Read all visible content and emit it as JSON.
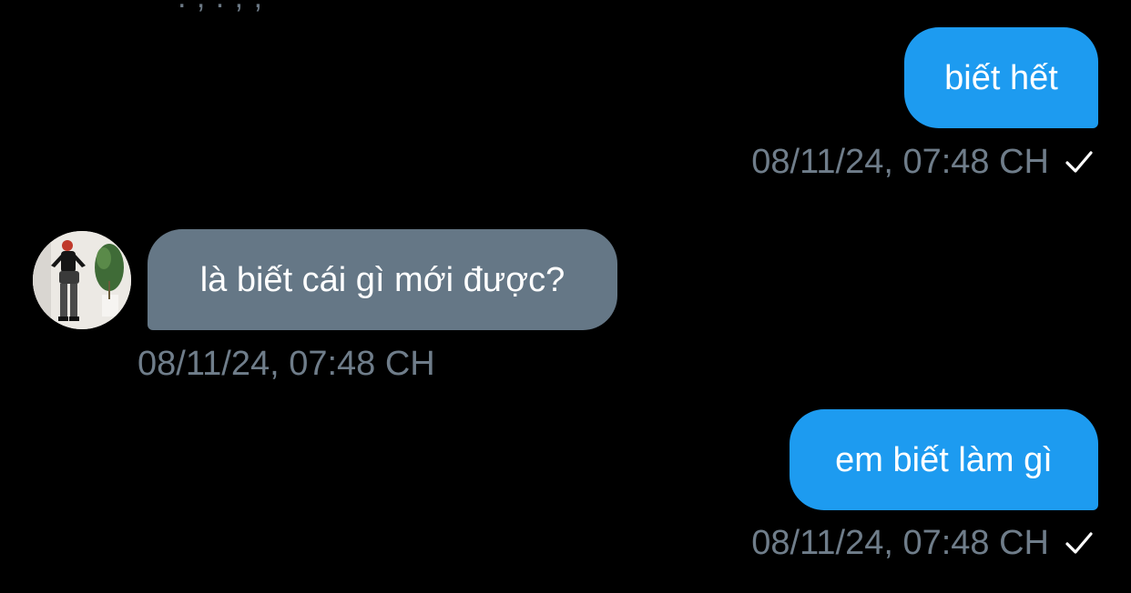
{
  "thread": {
    "cutoff_previous": ". , . ,   ,",
    "messages": [
      {
        "direction": "outgoing",
        "text": "biết hết",
        "timestamp": "08/11/24, 07:48 CH",
        "status_icon": "checkmark-icon"
      },
      {
        "direction": "incoming",
        "text": "là biết cái gì mới được?",
        "timestamp": "08/11/24, 07:48 CH",
        "avatar_icon": "user-avatar"
      },
      {
        "direction": "outgoing",
        "text": "em biết làm gì",
        "timestamp": "08/11/24, 07:48 CH",
        "status_icon": "checkmark-icon"
      }
    ]
  },
  "colors": {
    "background": "#000000",
    "outgoing_bubble": "#1d9bf0",
    "incoming_bubble": "#657786",
    "timestamp": "#6f7d8a",
    "bubble_text": "#ffffff"
  }
}
